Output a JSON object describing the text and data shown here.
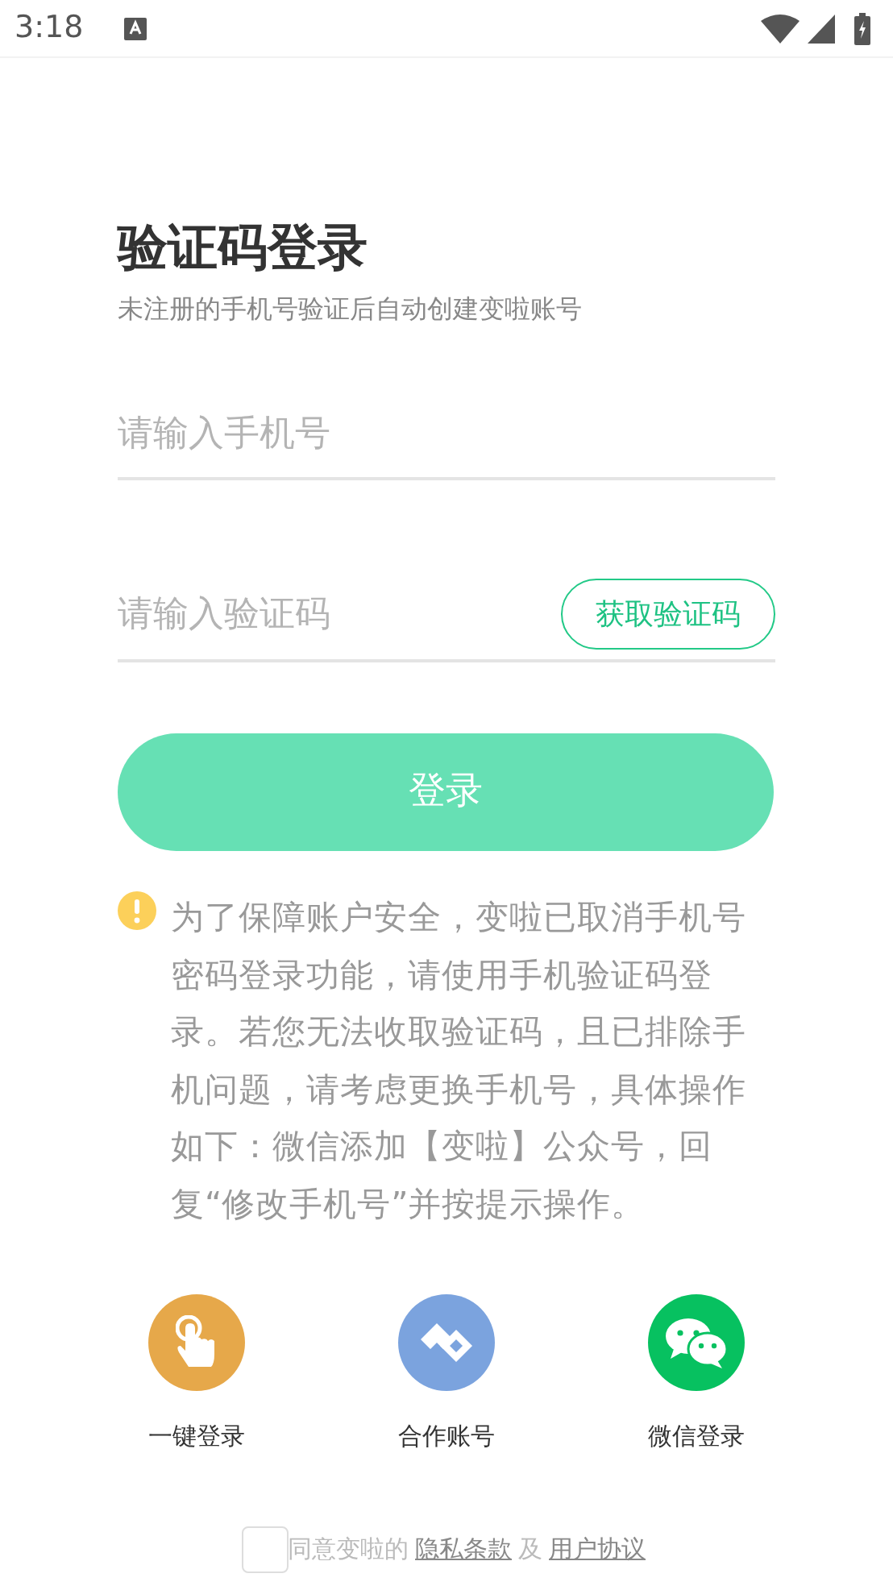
{
  "status_bar": {
    "time": "3:18"
  },
  "title": "验证码登录",
  "subtitle": "未注册的手机号验证后自动创建变啦账号",
  "phone_field": {
    "placeholder": "请输入手机号"
  },
  "code_field": {
    "placeholder": "请输入验证码",
    "button": "获取验证码"
  },
  "login_button": {
    "label": "登录",
    "disabled": true
  },
  "notice": "为了保障账户安全，变啦已取消手机号密码登录功能，请使用手机验证码登录。若您无法收取验证码，且已排除手机问题，请考虑更换手机号，具体操作如下：微信添加【变啦】公众号，回复“修改手机号”并按提示操作。",
  "login_options": [
    {
      "kind": "tap",
      "label": "一键登录",
      "color": "#e6a84a"
    },
    {
      "kind": "partner",
      "label": "合作账号",
      "color": "#7ba3de"
    },
    {
      "kind": "wechat",
      "label": "微信登录",
      "color": "#07c160"
    }
  ],
  "agreement": {
    "checked": false,
    "text": "同意变啦的",
    "privacy_link": "隐私条款",
    "conjunction": "及",
    "terms_link": "用户协议"
  }
}
